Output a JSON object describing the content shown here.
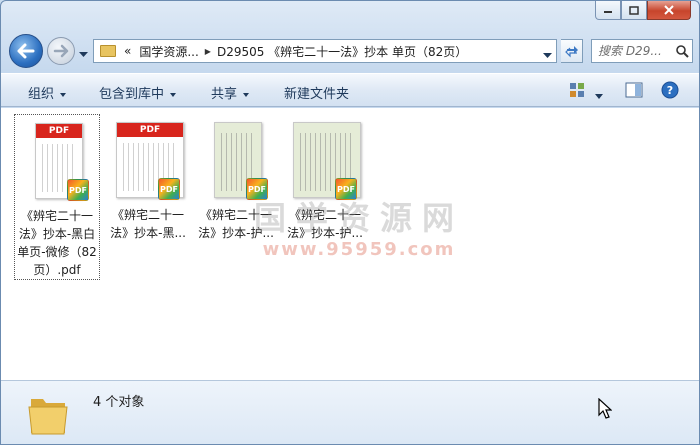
{
  "address": {
    "overflow": "«",
    "segments": [
      "国学资源...",
      "D29505 《辨宅二十一法》抄本 单页（82页）"
    ]
  },
  "search": {
    "placeholder": "搜索 D29..."
  },
  "toolbar": {
    "organize": "组织",
    "include_library": "包含到库中",
    "share": "共享",
    "new_folder": "新建文件夹"
  },
  "files": [
    {
      "name": "《辨宅二十一法》抄本-黑白单页-微修（82页）.pdf",
      "thumb": "pdf-banner",
      "pdf_label": "PDF",
      "selected": true
    },
    {
      "name": "《辨宅二十一法》抄本-黑...",
      "thumb": "pdf-banner-wide",
      "pdf_label": "PDF",
      "selected": false
    },
    {
      "name": "《辨宅二十一法》抄本-护...",
      "thumb": "scan-green",
      "selected": false
    },
    {
      "name": "《辨宅二十一法》抄本-护...",
      "thumb": "scan-green-wide",
      "selected": false
    }
  ],
  "badge_label": "PDF",
  "watermark": {
    "cn": "国学资源网",
    "url": "www.95959.com"
  },
  "status": {
    "count_text": "4 个对象"
  },
  "colors": {
    "accent": "#2c6fc0",
    "pdf_red": "#d8251d",
    "close_red": "#c7452c"
  }
}
